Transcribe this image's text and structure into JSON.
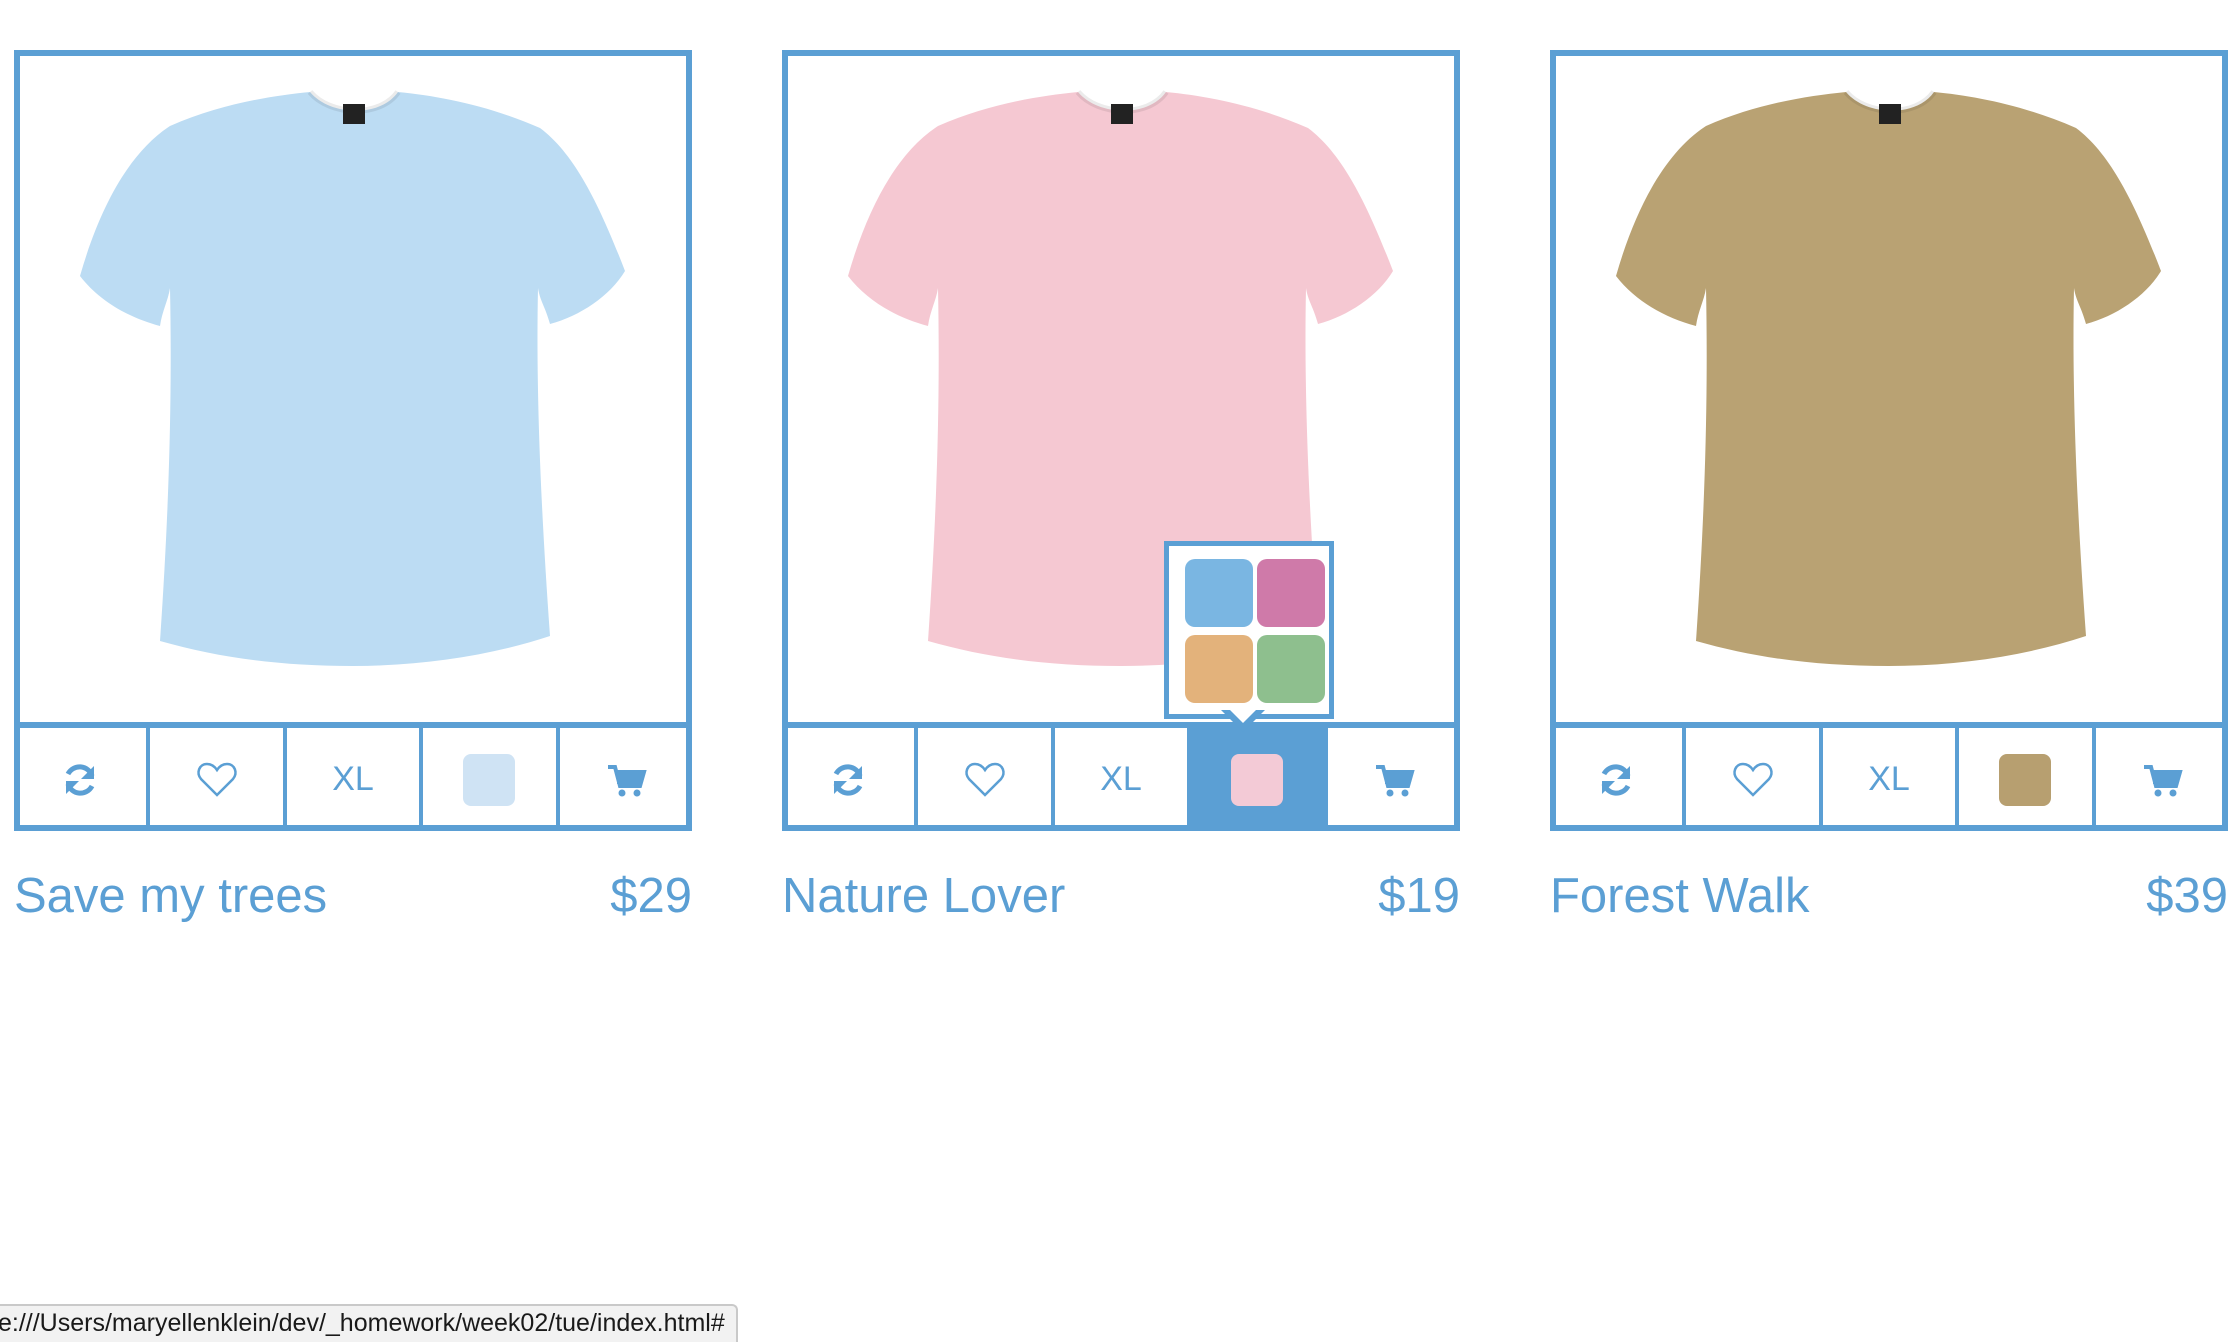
{
  "products": [
    {
      "name": "Save my trees",
      "price": "$29",
      "size_label": "XL",
      "shirt_color": "#bcdcf3",
      "swatch_color": "#cfe3f4",
      "icons": [
        "refresh-icon",
        "heart-icon",
        "size-label",
        "color-swatch",
        "cart-icon"
      ]
    },
    {
      "name": "Nature Lover",
      "price": "$19",
      "size_label": "XL",
      "shirt_color": "#f5c8d2",
      "swatch_color": "#f3cad6",
      "color_tool_active": true,
      "icons": [
        "refresh-icon",
        "heart-icon",
        "size-label",
        "color-swatch",
        "cart-icon"
      ]
    },
    {
      "name": "Forest Walk",
      "price": "$39",
      "size_label": "XL",
      "shirt_color": "#b9a273",
      "swatch_color": "#b79f70",
      "icons": [
        "refresh-icon",
        "heart-icon",
        "size-label",
        "color-swatch",
        "cart-icon"
      ]
    }
  ],
  "color_picker": {
    "options": [
      {
        "name": "blue",
        "color": "#7ab6e2"
      },
      {
        "name": "magenta",
        "color": "#cf7aa9"
      },
      {
        "name": "orange",
        "color": "#e3b27b"
      },
      {
        "name": "green",
        "color": "#8ebf8e"
      }
    ]
  },
  "accent_color": "#5b9fd4",
  "status_bar": {
    "url": "e:///Users/maryellenklein/dev/_homework/week02/tue/index.html#"
  }
}
